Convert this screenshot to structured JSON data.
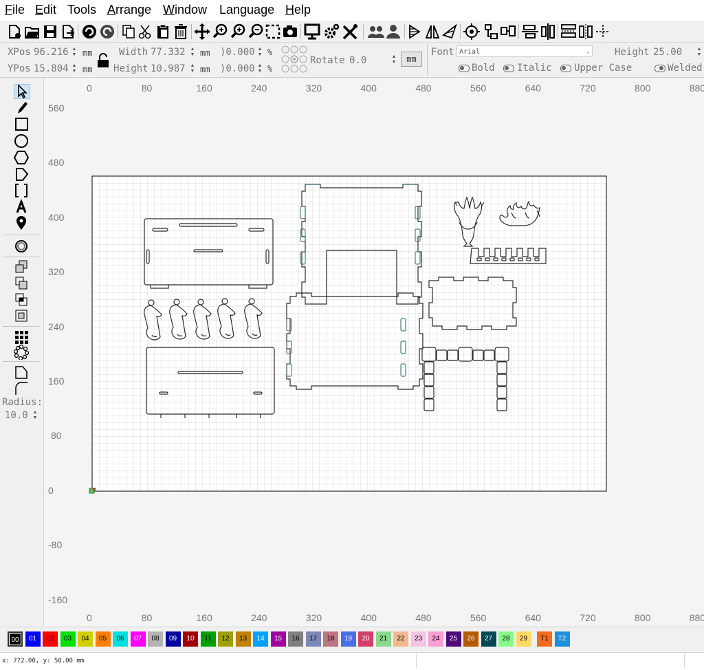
{
  "menu": [
    "File",
    "Edit",
    "Tools",
    "Arrange",
    "Window",
    "Language",
    "Help"
  ],
  "menu_underline": [
    "F",
    "E",
    "",
    "A",
    "W",
    "",
    "H"
  ],
  "props": {
    "xpos_label": "XPos",
    "xpos_value": "96.216",
    "ypos_label": "YPos",
    "ypos_value": "15.804",
    "width_label": "Width",
    "width_value": "77.332",
    "height_label": "Height",
    "height_value": "10.987",
    "scale_w": ")0.000",
    "scale_h": ")0.000",
    "percent": "%",
    "unit": "mm",
    "rotate_label": "Rotate",
    "rotate_value": "0.0",
    "unit_button": "mm"
  },
  "font": {
    "label": "Font",
    "name": "Arial",
    "height_label": "Height",
    "height_value": "25.00",
    "bold": "Bold",
    "italic": "Italic",
    "upper_case": "Upper Case",
    "welded": "Welded"
  },
  "left": {
    "radius_label": "Radius:",
    "radius_value": "10.0"
  },
  "rulers": {
    "top": [
      "0",
      "80",
      "160",
      "240",
      "320",
      "400",
      "480",
      "560",
      "640",
      "720",
      "800",
      "880"
    ],
    "left": [
      "560",
      "480",
      "400",
      "320",
      "240",
      "160",
      "80",
      "0",
      "-80",
      "-160"
    ]
  },
  "palette": [
    {
      "label": "00",
      "color": "#000000",
      "fg": "#ffffff"
    },
    {
      "label": "01",
      "color": "#0000ff",
      "fg": "#ffffff"
    },
    {
      "label": "02",
      "color": "#ff0000",
      "fg": "#000000"
    },
    {
      "label": "03",
      "color": "#00e000",
      "fg": "#000000"
    },
    {
      "label": "04",
      "color": "#d0d000",
      "fg": "#000000"
    },
    {
      "label": "05",
      "color": "#ff8000",
      "fg": "#000000"
    },
    {
      "label": "06",
      "color": "#00e0e0",
      "fg": "#000000"
    },
    {
      "label": "07",
      "color": "#ff00ff",
      "fg": "#ffffff"
    },
    {
      "label": "08",
      "color": "#b4b4b4",
      "fg": "#000000"
    },
    {
      "label": "09",
      "color": "#0000a0",
      "fg": "#ffffff"
    },
    {
      "label": "10",
      "color": "#a00000",
      "fg": "#ffffff"
    },
    {
      "label": "11",
      "color": "#00a000",
      "fg": "#000000"
    },
    {
      "label": "12",
      "color": "#a0a000",
      "fg": "#000000"
    },
    {
      "label": "13",
      "color": "#c08000",
      "fg": "#000000"
    },
    {
      "label": "14",
      "color": "#00a0ff",
      "fg": "#ffffff"
    },
    {
      "label": "15",
      "color": "#a000a0",
      "fg": "#ffffff"
    },
    {
      "label": "16",
      "color": "#808080",
      "fg": "#000000"
    },
    {
      "label": "17",
      "color": "#7d87b9",
      "fg": "#000000"
    },
    {
      "label": "18",
      "color": "#bb7784",
      "fg": "#000000"
    },
    {
      "label": "19",
      "color": "#4a6fe3",
      "fg": "#ffffff"
    },
    {
      "label": "20",
      "color": "#d33f6a",
      "fg": "#ffffff"
    },
    {
      "label": "21",
      "color": "#8cd78c",
      "fg": "#000000"
    },
    {
      "label": "22",
      "color": "#f0b98d",
      "fg": "#000000"
    },
    {
      "label": "23",
      "color": "#f6c4e1",
      "fg": "#000000"
    },
    {
      "label": "24",
      "color": "#fa9ed4",
      "fg": "#000000"
    },
    {
      "label": "25",
      "color": "#500a78",
      "fg": "#ffffff"
    },
    {
      "label": "26",
      "color": "#b45a00",
      "fg": "#ffffff"
    },
    {
      "label": "27",
      "color": "#004754",
      "fg": "#ffffff"
    },
    {
      "label": "28",
      "color": "#86fa88",
      "fg": "#000000"
    },
    {
      "label": "29",
      "color": "#ffdb66",
      "fg": "#000000"
    },
    {
      "label": "T1",
      "color": "#f36b1c",
      "fg": "#000000"
    },
    {
      "label": "T2",
      "color": "#1d8fd8",
      "fg": "#ffffff"
    }
  ],
  "status": {
    "coords": "x: 772.00, y: 50.00 mm"
  }
}
